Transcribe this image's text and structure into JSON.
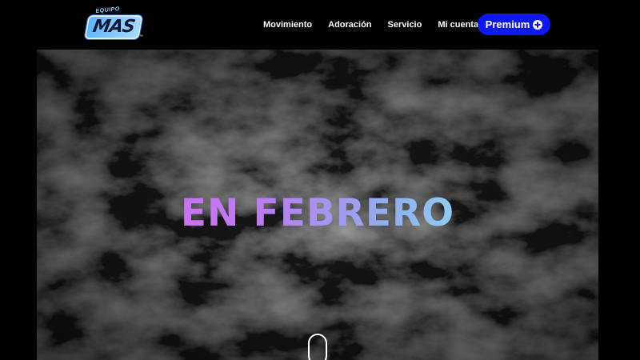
{
  "header": {
    "logo": {
      "eyebrow": "EQUIPO",
      "word": "MAS",
      "trademark": "™"
    },
    "nav": [
      {
        "label": "Movimiento"
      },
      {
        "label": "Adoración"
      },
      {
        "label": "Servicio"
      },
      {
        "label": "Mi cuenta"
      }
    ],
    "premium_button": {
      "label": "Premium",
      "icon": "plus-circle-icon",
      "color": "#0b17f5"
    }
  },
  "hero": {
    "title": "EN FEBRERO",
    "title_gradient": [
      "#d06df0",
      "#b77ff0",
      "#8fb3f0",
      "#95e6f0"
    ],
    "scroll_icon": "mouse-scroll-icon"
  }
}
